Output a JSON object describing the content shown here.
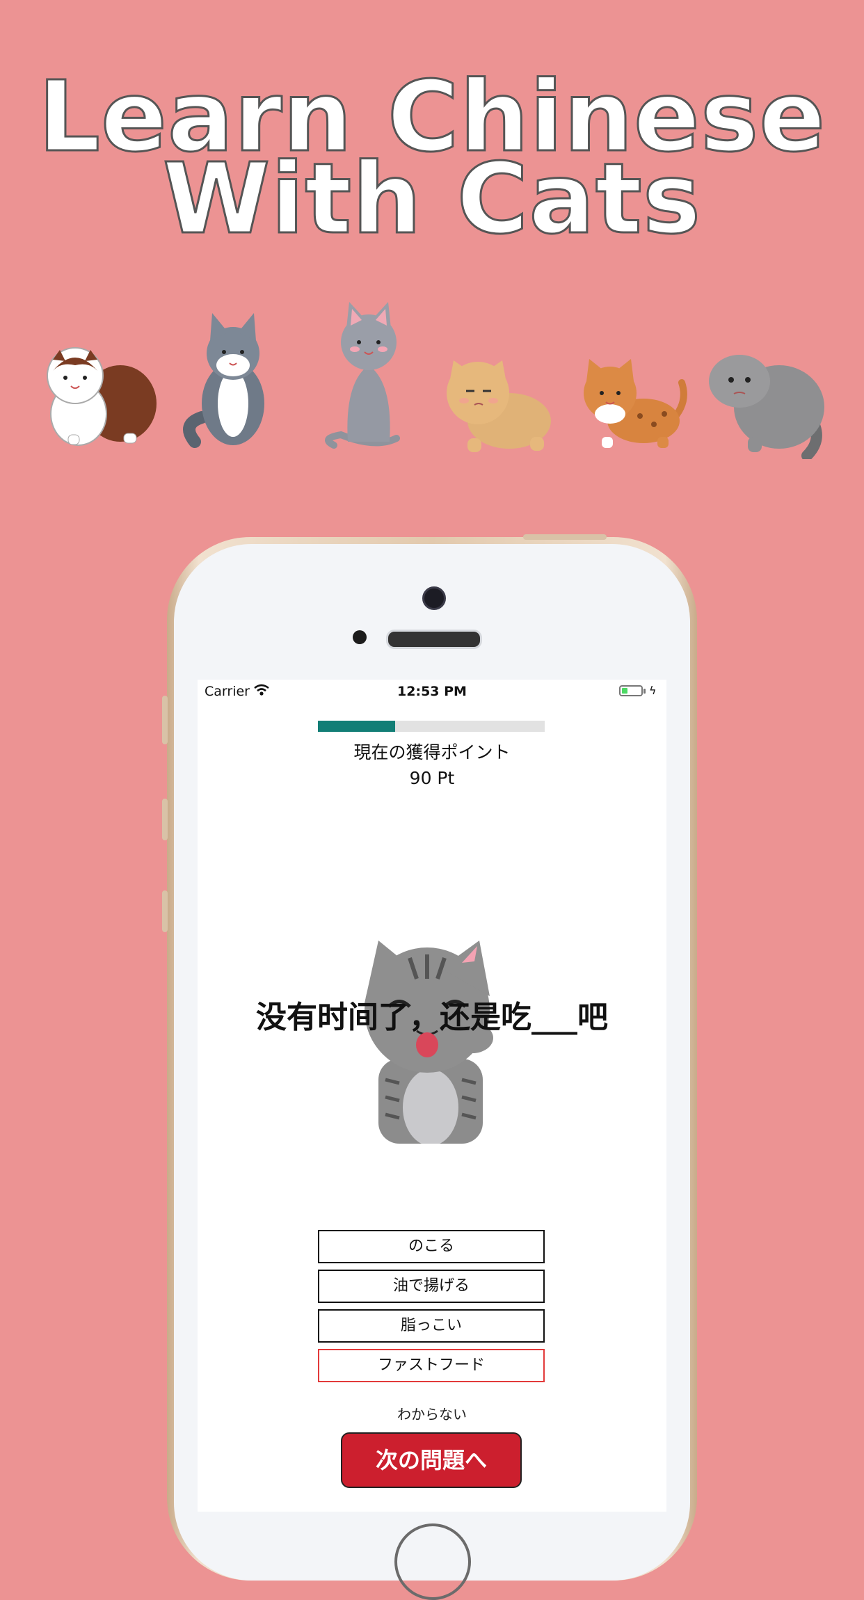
{
  "hero": {
    "title_line1": "Learn Chinese",
    "title_line2": "With Cats"
  },
  "cat_lineup": [
    "calico-cat-icon",
    "maine-coon-cat-icon",
    "gray-cat-icon",
    "exotic-shorthair-cat-icon",
    "bengal-cat-icon",
    "pallas-cat-icon"
  ],
  "status_bar": {
    "carrier": "Carrier",
    "time": "12:53 PM",
    "battery_level": 0.3
  },
  "quiz": {
    "progress": 0.34,
    "points_label": "現在の獲得ポイント",
    "points_value": "90 Pt",
    "question": "没有时间了，还是吃___吧",
    "choices": [
      "のこる",
      "油で揚げる",
      "脂っこい",
      "ファストフード"
    ],
    "selected_choice_index": 3,
    "unknown_label": "わからない",
    "next_button_label": "次の問題へ"
  },
  "colors": {
    "background": "#ec9393",
    "progress": "#127e76",
    "next_button": "#cc1f2e",
    "selected_border": "#e23a3a"
  }
}
